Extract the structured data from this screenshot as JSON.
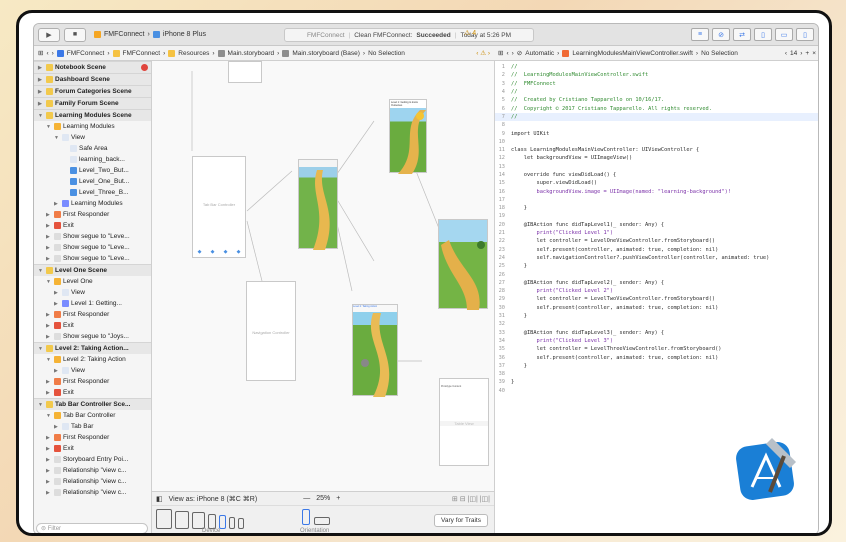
{
  "toolbar": {
    "scheme_app": "FMFConnect",
    "scheme_device": "iPhone 8 Plus",
    "status_app": "FMFConnect",
    "status_action": "Clean FMFConnect:",
    "status_result": "Succeeded",
    "status_time": "Today at 5:26 PM",
    "warning_count": "4"
  },
  "jump_left": [
    "FMFConnect",
    "FMFConnect",
    "Resources",
    "Main.storyboard",
    "Main.storyboard (Base)",
    "No Selection"
  ],
  "jump_right": {
    "automatic": "Automatic",
    "file": "LearningModulesMainViewController.swift",
    "selection": "No Selection",
    "counter": "14"
  },
  "outline": [
    {
      "t": "Notebook Scene",
      "lvl": 0,
      "scene": true,
      "c": "#f2c94c",
      "badge": true
    },
    {
      "t": "Dashboard Scene",
      "lvl": 0,
      "scene": true,
      "c": "#f2c94c"
    },
    {
      "t": "Forum Categories Scene",
      "lvl": 0,
      "scene": true,
      "c": "#f2c94c"
    },
    {
      "t": "Family Forum Scene",
      "lvl": 0,
      "scene": true,
      "c": "#f2c94c"
    },
    {
      "t": "Learning Modules Scene",
      "lvl": 0,
      "scene": true,
      "c": "#f2c94c",
      "open": true
    },
    {
      "t": "Learning Modules",
      "lvl": 1,
      "c": "#f5b335",
      "open": true
    },
    {
      "t": "View",
      "lvl": 2,
      "c": "#dfe7f3",
      "open": true
    },
    {
      "t": "Safe Area",
      "lvl": 3,
      "c": "#dfe7f3"
    },
    {
      "t": "learning_back...",
      "lvl": 3,
      "c": "#dfe7f3"
    },
    {
      "t": "Level_Two_But...",
      "lvl": 3,
      "c": "#4a90e2"
    },
    {
      "t": "Level_One_But...",
      "lvl": 3,
      "c": "#4a90e2"
    },
    {
      "t": "Level_Three_B...",
      "lvl": 3,
      "c": "#4a90e2"
    },
    {
      "t": "Learning Modules",
      "lvl": 2,
      "c": "#7a8cff"
    },
    {
      "t": "First Responder",
      "lvl": 1,
      "c": "#f07c47"
    },
    {
      "t": "Exit",
      "lvl": 1,
      "c": "#e5533d"
    },
    {
      "t": "Show segue to \"Leve...",
      "lvl": 1,
      "c": "#ddd"
    },
    {
      "t": "Show segue to \"Leve...",
      "lvl": 1,
      "c": "#ddd"
    },
    {
      "t": "Show segue to \"Leve...",
      "lvl": 1,
      "c": "#ddd"
    },
    {
      "t": "Level One Scene",
      "lvl": 0,
      "scene": true,
      "c": "#f2c94c",
      "open": true
    },
    {
      "t": "Level One",
      "lvl": 1,
      "c": "#f5b335",
      "open": true
    },
    {
      "t": "View",
      "lvl": 2,
      "c": "#dfe7f3"
    },
    {
      "t": "Level 1: Getting...",
      "lvl": 2,
      "c": "#7a8cff"
    },
    {
      "t": "First Responder",
      "lvl": 1,
      "c": "#f07c47"
    },
    {
      "t": "Exit",
      "lvl": 1,
      "c": "#e5533d"
    },
    {
      "t": "Show segue to \"Joys...",
      "lvl": 1,
      "c": "#ddd"
    },
    {
      "t": "Level 2: Taking Action...",
      "lvl": 0,
      "scene": true,
      "c": "#f2c94c",
      "open": true
    },
    {
      "t": "Level 2: Taking Action",
      "lvl": 1,
      "c": "#f5b335",
      "open": true
    },
    {
      "t": "View",
      "lvl": 2,
      "c": "#dfe7f3"
    },
    {
      "t": "First Responder",
      "lvl": 1,
      "c": "#f07c47"
    },
    {
      "t": "Exit",
      "lvl": 1,
      "c": "#e5533d"
    },
    {
      "t": "Tab Bar Controller Sce...",
      "lvl": 0,
      "scene": true,
      "c": "#f2c94c",
      "open": true
    },
    {
      "t": "Tab Bar Controller",
      "lvl": 1,
      "c": "#f5b335",
      "open": true
    },
    {
      "t": "Tab Bar",
      "lvl": 2,
      "c": "#dfe7f3"
    },
    {
      "t": "First Responder",
      "lvl": 1,
      "c": "#f07c47"
    },
    {
      "t": "Exit",
      "lvl": 1,
      "c": "#e5533d"
    },
    {
      "t": "Storyboard Entry Poi...",
      "lvl": 1,
      "c": "#ddd"
    },
    {
      "t": "Relationship \"view c...",
      "lvl": 1,
      "c": "#ddd"
    },
    {
      "t": "Relationship \"view c...",
      "lvl": 1,
      "c": "#ddd"
    },
    {
      "t": "Relationship \"view c...",
      "lvl": 1,
      "c": "#ddd"
    }
  ],
  "filter_placeholder": "Filter",
  "canvas": {
    "tab_bar_label": "Tab Bar Controller",
    "nav_label": "Navigation Controller",
    "table_label": "Table View",
    "table_sub": "Prototype Content",
    "level1_title": "Level 1: Getting to know Ourselves",
    "level2_title": "Level 2: Taking Action"
  },
  "bottom": {
    "view_as": "View as: iPhone 8 (⌘C ⌘R)",
    "zoom": "25%",
    "device_label": "Device",
    "orientation_label": "Orientation",
    "vary_button": "Vary for Traits"
  },
  "code": [
    [
      "//",
      ""
    ],
    [
      "//  LearningModulesMainViewController.swift",
      ""
    ],
    [
      "//  FMFConnect",
      ""
    ],
    [
      "//",
      ""
    ],
    [
      "//  Created by Cristiano Tapparello on 10/16/17.",
      ""
    ],
    [
      "//  Copyright © 2017 Cristiano Tapparello. All rights reserved.",
      ""
    ],
    [
      "//",
      ""
    ],
    [
      "",
      ""
    ],
    [
      "import UIKit",
      "k"
    ],
    [
      "",
      ""
    ],
    [
      "class LearningModulesMainViewController: UIViewController {",
      "k"
    ],
    [
      "    let backgroundView = UIImageView()",
      "k"
    ],
    [
      "",
      ""
    ],
    [
      "    override func viewDidLoad() {",
      "k"
    ],
    [
      "        super.viewDidLoad()",
      "k"
    ],
    [
      "        backgroundView.image = UIImage(named: \"learning-background\")!",
      "k"
    ],
    [
      "",
      ""
    ],
    [
      "    }",
      ""
    ],
    [
      "",
      ""
    ],
    [
      "    @IBAction func didTapLevel1(_ sender: Any) {",
      "k"
    ],
    [
      "        print(\"Clicked Level 1\")",
      "k"
    ],
    [
      "        let controller = LevelOneViewController.fromStoryboard()",
      "k"
    ],
    [
      "        self.present(controller, animated: true, completion: nil)",
      "k"
    ],
    [
      "        self.navigationController?.pushViewController(controller, animated: true)",
      "k"
    ],
    [
      "    }",
      ""
    ],
    [
      "",
      ""
    ],
    [
      "    @IBAction func didTapLevel2(_ sender: Any) {",
      "k"
    ],
    [
      "        print(\"Clicked Level 2\")",
      "k"
    ],
    [
      "        let controller = LevelTwoViewController.fromStoryboard()",
      "k"
    ],
    [
      "        self.present(controller, animated: true, completion: nil)",
      "k"
    ],
    [
      "    }",
      ""
    ],
    [
      "",
      ""
    ],
    [
      "    @IBAction func didTapLevel3(_ sender: Any) {",
      "k"
    ],
    [
      "        print(\"Clicked Level 3\")",
      "k"
    ],
    [
      "        let controller = LevelThreeViewController.fromStoryboard()",
      "k"
    ],
    [
      "        self.present(controller, animated: true, completion: nil)",
      "k"
    ],
    [
      "    }",
      ""
    ],
    [
      "",
      ""
    ],
    [
      "}",
      ""
    ],
    [
      "",
      ""
    ]
  ],
  "xcode_logo_label": "Xcode"
}
